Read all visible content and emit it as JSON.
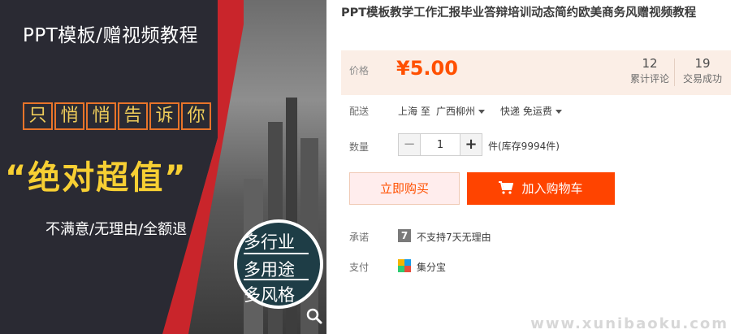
{
  "banner": {
    "title": "PPT模板/赠视频教程",
    "boxes": [
      "只",
      "悄",
      "悄",
      "告",
      "诉",
      "你"
    ],
    "slogan": "“绝对超值”",
    "guarantee": "不满意/无理由/全额退",
    "circle_lines": [
      "多行业",
      "多用途",
      "多风格"
    ]
  },
  "product": {
    "title": "PPT模板教学工作汇报毕业答辩培训动态简约欧美商务风赠视频教程"
  },
  "price": {
    "label": "价格",
    "value": "¥5.00",
    "reviews_count": "12",
    "reviews_label": "累计评论",
    "deals_count": "19",
    "deals_label": "交易成功"
  },
  "shipping": {
    "label": "配送",
    "origin": "上海 至",
    "destination": "广西柳州",
    "method": "快递 免运费"
  },
  "quantity": {
    "label": "数量",
    "minus": "−",
    "value": "1",
    "plus": "+",
    "stock": "件(库存9994件)"
  },
  "actions": {
    "buy_now": "立即购买",
    "add_to_cart": "加入购物车"
  },
  "promise": {
    "label": "承诺",
    "icon_text": "7",
    "text": "不支持7天无理由"
  },
  "payment": {
    "label": "支付",
    "text": "集分宝"
  },
  "watermark": "www.xunibaoku.com",
  "colors": {
    "accent": "#ff5000",
    "cart_button": "#ff4400",
    "price_bg": "#fbeee6",
    "banner_yellow": "#f7cf33",
    "banner_red": "#c9252b"
  }
}
